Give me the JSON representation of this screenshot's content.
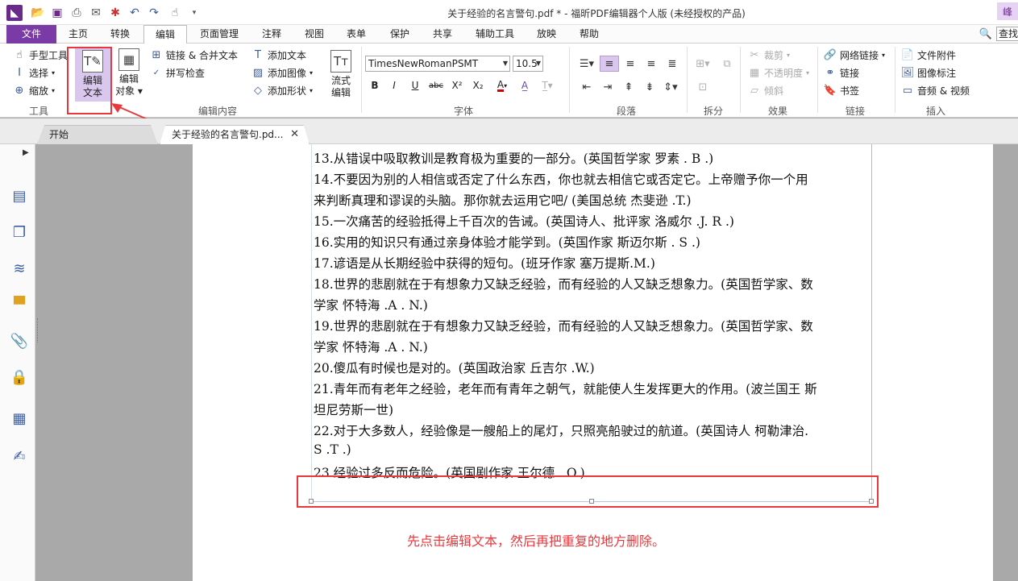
{
  "titlebar": {
    "title": "关于经验的名言警句.pdf * - 福昕PDF编辑器个人版 (未经授权的产品)",
    "user": "峰"
  },
  "menu": {
    "tabs": [
      "文件",
      "主页",
      "转换",
      "编辑",
      "页面管理",
      "注释",
      "视图",
      "表单",
      "保护",
      "共享",
      "辅助工具",
      "放映",
      "帮助"
    ],
    "search_label": "查找"
  },
  "ribbon": {
    "tools": {
      "hand": "手型工具",
      "select": "选择",
      "zoom": "缩放",
      "group": "工具"
    },
    "edit": {
      "edit_text": "编辑文本",
      "edit_text_l1": "编辑",
      "edit_text_l2": "文本",
      "edit_object_l1": "编辑",
      "edit_object_l2": "对象",
      "link_merge": "链接 & 合并文本",
      "spell": "拼写检查",
      "add_text": "添加文本",
      "add_image": "添加图像",
      "add_shape": "添加形状",
      "flow_l1": "流式",
      "flow_l2": "编辑",
      "group": "编辑内容"
    },
    "font": {
      "name": "TimesNewRomanPSMT",
      "size": "10.5",
      "group": "字体"
    },
    "paragraph": {
      "group": "段落"
    },
    "split": {
      "group": "拆分"
    },
    "effects": {
      "crop": "裁剪",
      "opacity": "不透明度",
      "skew": "倾斜",
      "group": "效果"
    },
    "links": {
      "web_link": "网络链接",
      "link": "链接",
      "bookmark": "书签",
      "group": "链接"
    },
    "insert": {
      "attachment": "文件附件",
      "image_annot": "图像标注",
      "audio_video": "音频 & 视频",
      "group": "插入"
    }
  },
  "doc_tabs": {
    "home": "开始",
    "active": "关于经验的名言警句.pd..."
  },
  "document": {
    "lines": [
      "13.从错误中吸取教训是教育极为重要的一部分。(英国哲学家  罗素  . B .)",
      "14.不要因为别的人相信或否定了什么东西，你也就去相信它或否定它。上帝赠予你一个用",
      "来判断真理和谬误的头脑。那你就去运用它吧/ (美国总统  杰斐逊  .T.)",
      "15.一次痛苦的经验抵得上千百次的告诫。(英国诗人、批评家  洛威尔  .J. R .)",
      "16.实用的知识只有通过亲身体验才能学到。(英国作家  斯迈尔斯  . S .)",
      "17.谚语是从长期经验中获得的短句。(班牙作家  塞万提斯.M.)",
      "18.世界的悲剧就在于有想象力又缺乏经验，而有经验的人又缺乏想象力。(英国哲学家、数",
      "学家  怀特海  .A . N.)",
      "19.世界的悲剧就在于有想象力又缺乏经验，而有经验的人又缺乏想象力。(英国哲学家、数",
      "学家  怀特海  .A . N.)",
      "20.傻瓜有时候也是对的。(英国政治家  丘吉尔  .W.)",
      "21.青年而有老年之经验，老年而有青年之朝气，就能使人生发挥更大的作用。(波兰国王  斯",
      "坦尼劳斯一世)",
      "22.对于大多数人，经验像是一艘船上的尾灯，只照亮船驶过的航道。(英国诗人  柯勒津治.",
      "S .T .)",
      "23.经验过多反而危险。(英国剧作家  王尔德  . O.)"
    ]
  },
  "annotation": {
    "instruction": "先点击编辑文本，然后再把重复的地方删除。",
    "color": "#e8383d"
  },
  "colors": {
    "accent": "#7b3ba6",
    "highlight": "#d9c7ee"
  }
}
